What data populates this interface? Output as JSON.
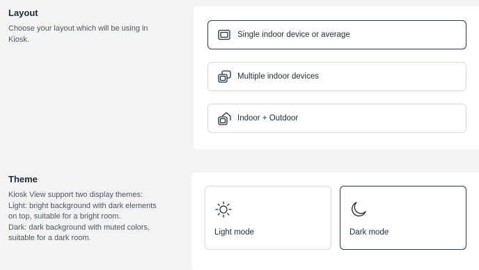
{
  "layout": {
    "title": "Layout",
    "description": "Choose your layout which will be using in Kiosk.",
    "options": [
      {
        "label": "Single indoor device or average",
        "icon": "single-device-icon",
        "selected": true
      },
      {
        "label": "Multiple indoor devices",
        "icon": "multiple-devices-icon",
        "selected": false
      },
      {
        "label": "Indoor + Outdoor",
        "icon": "indoor-outdoor-icon",
        "selected": false
      }
    ]
  },
  "theme": {
    "title": "Theme",
    "description": "Kiosk View support two display themes:\nLight: bright background with dark elements on top, suitable for a bright room.\nDark: dark background with muted colors, suitable for a dark room.",
    "modes": [
      {
        "label": "Light mode",
        "icon": "sun-icon",
        "selected": false
      },
      {
        "label": "Dark mode",
        "icon": "moon-icon",
        "selected": true
      }
    ]
  },
  "colors": {
    "selected_border": "#2a3a48",
    "border": "#d6dbe0",
    "background": "#f4f4f4"
  }
}
